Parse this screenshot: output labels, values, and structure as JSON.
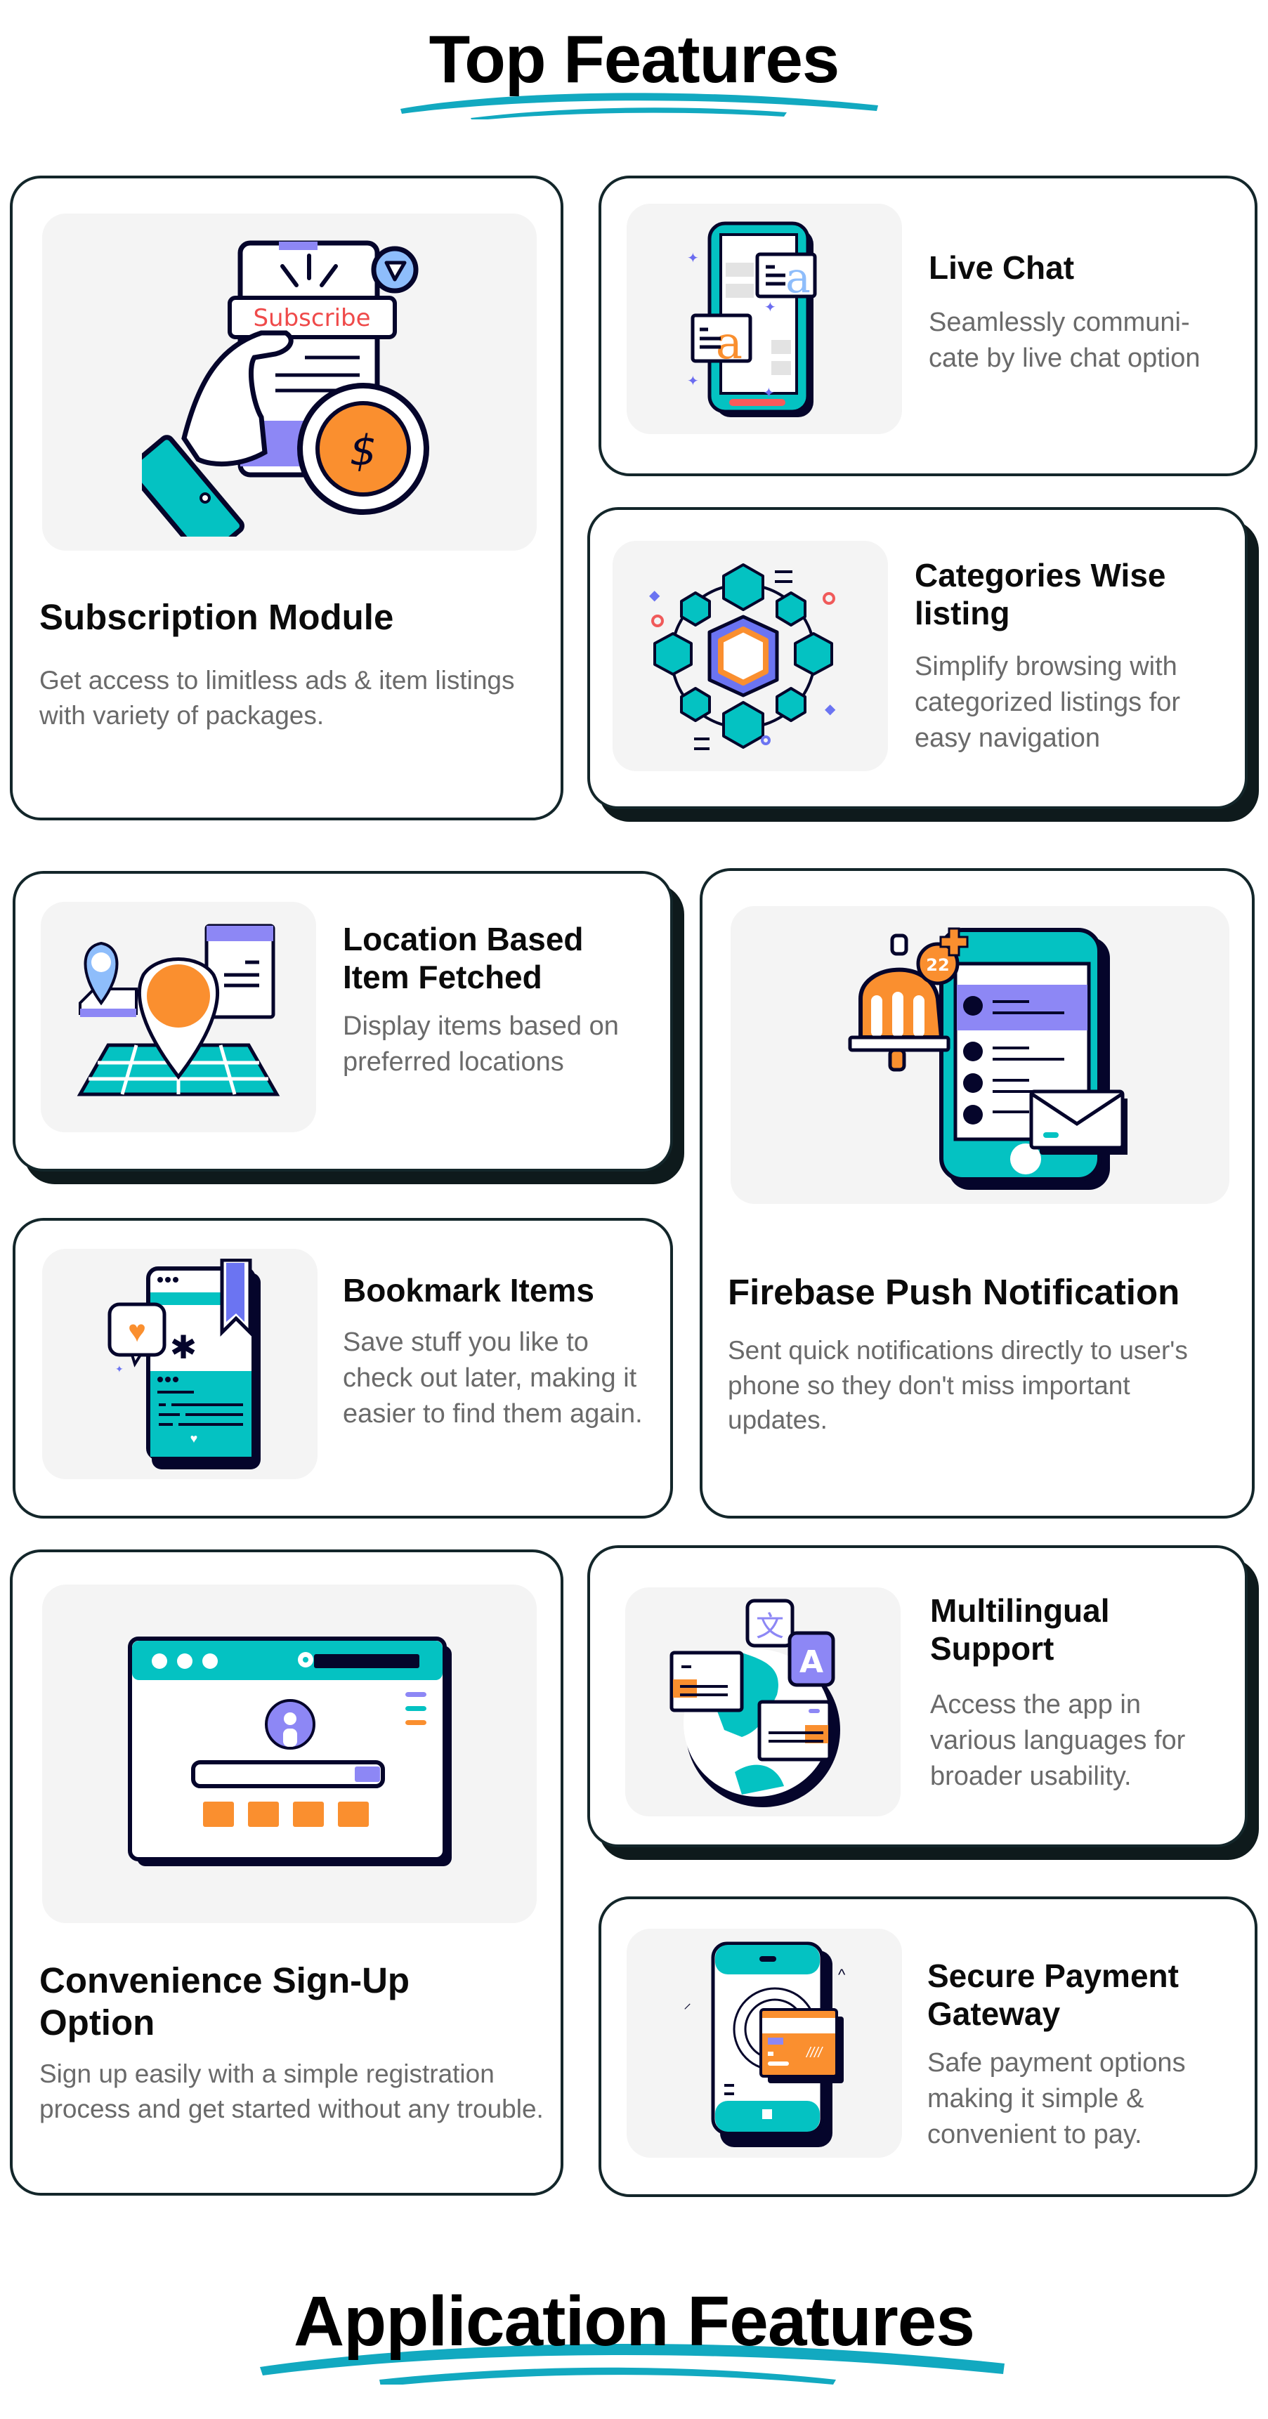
{
  "headings": {
    "top": "Top Features",
    "bottom": "Application Features"
  },
  "colors": {
    "accent_teal": "#04c2c2",
    "swoosh": "#12a9c0",
    "orange": "#fa8f2f",
    "purple": "#8d87f5",
    "navy": "#05052b",
    "card_border": "#13262a",
    "description": "#6a6a6a"
  },
  "features": [
    {
      "id": "subscription",
      "title": "Subscription Module",
      "description": "Get access to limitless ads & item listings with variety of packages.",
      "icon": "subscribe-phone-illustration",
      "illustration_label": "Subscribe"
    },
    {
      "id": "live-chat",
      "title": "Live Chat",
      "description": "Seamlessly communi-cate by live chat option",
      "icon": "chat-phone-illustration"
    },
    {
      "id": "categories",
      "title": "Categories Wise listing",
      "description": "Simplify browsing with categorized listings for easy navigation",
      "icon": "category-hexagon-illustration"
    },
    {
      "id": "location",
      "title": "Location Based Item Fetched",
      "description": "Display items based on preferred locations",
      "icon": "location-pin-map-illustration"
    },
    {
      "id": "push",
      "title": "Firebase Push Notification",
      "description": "Sent quick notifications directly to user's phone so they don't miss important updates.",
      "icon": "notification-bell-phone-illustration",
      "badge_count": "22"
    },
    {
      "id": "bookmark",
      "title": "Bookmark Items",
      "description": "Save stuff you like to check out later, making it easier to find them again.",
      "icon": "bookmark-phone-illustration"
    },
    {
      "id": "signup",
      "title": "Convenience Sign-Up Option",
      "description": "Sign up easily with a simple registration process and get started without any trouble.",
      "icon": "signup-browser-illustration"
    },
    {
      "id": "multilingual",
      "title": "Multilingual Support",
      "description": "Access the app in various languages for broader usability.",
      "icon": "translate-globe-illustration",
      "glyphs": [
        "文",
        "A"
      ]
    },
    {
      "id": "payment",
      "title": "Secure Payment Gateway",
      "description": "Safe payment options making it simple & convenient to pay.",
      "icon": "payment-card-phone-illustration"
    }
  ]
}
